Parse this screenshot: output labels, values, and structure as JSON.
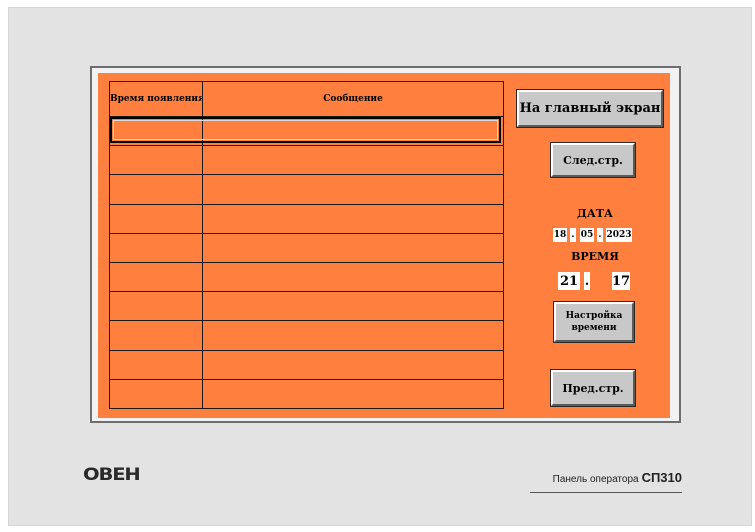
{
  "table": {
    "headers": [
      "Время появления",
      "Сообщение"
    ],
    "rows": [
      [
        "",
        ""
      ],
      [
        "",
        ""
      ],
      [
        "",
        ""
      ],
      [
        "",
        ""
      ],
      [
        "",
        ""
      ],
      [
        "",
        ""
      ],
      [
        "",
        ""
      ],
      [
        "",
        ""
      ],
      [
        "",
        ""
      ],
      [
        "",
        ""
      ]
    ]
  },
  "buttons": {
    "home": "На главный экран",
    "next": "След.стр.",
    "set_time_line1": "Настройка",
    "set_time_line2": "времени",
    "prev": "Пред.стр."
  },
  "date": {
    "label": "ДАТА",
    "day": "18",
    "month": "05",
    "year": "2023",
    "separator": "."
  },
  "time": {
    "label": "ВРЕМЯ",
    "hour": "21",
    "minute": "17",
    "separator": "."
  },
  "device": {
    "brand": "ОВЕН",
    "model_prefix": "Панель оператора",
    "model_name": "СП310"
  },
  "colors": {
    "screen": "#ff7f3f",
    "button": "#c8c8c8",
    "bezel": "#e3e3e3"
  }
}
